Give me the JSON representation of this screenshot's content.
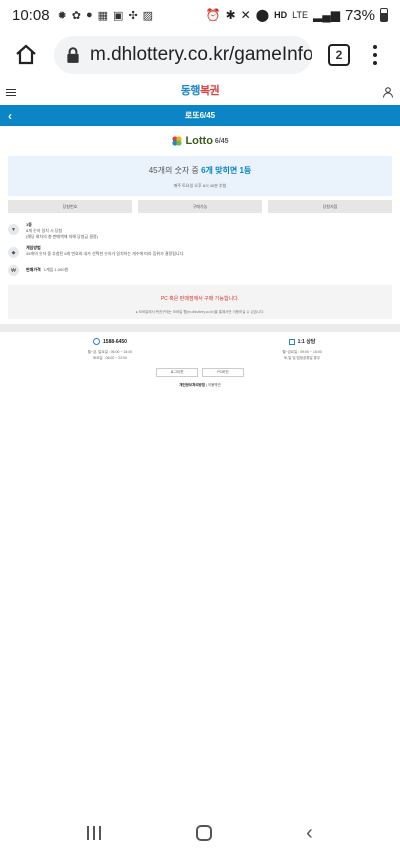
{
  "status_bar": {
    "time": "10:08",
    "battery": "73%",
    "network_hd": "HD",
    "network_lte": "LTE"
  },
  "chrome": {
    "url": "m.dhlottery.co.kr/gameInfo.",
    "tab_count": "2"
  },
  "site": {
    "logo_text_1": "동행",
    "logo_text_2": "복권",
    "page_title": "로또6/45"
  },
  "lotto": {
    "logo_text": "Lotto",
    "logo_sub": "6/45",
    "headline_prefix": "45개의 숫자 중 ",
    "headline_bold": "6개 맞히면 1등",
    "subline": "매주 토요일 오후 8시 45분 추첨"
  },
  "buttons": [
    "당첨번호",
    "구매가능",
    "당첨지점"
  ],
  "rules": [
    {
      "icon": "trophy-icon",
      "icon_glyph": "▼",
      "title": "1등",
      "lines": [
        "6개 숫자 일치 시 당첨",
        "(해당 회차의 총 판매액에 의해 당첨금 결정)"
      ]
    },
    {
      "icon": "game-icon",
      "icon_glyph": "◆",
      "title": "게임방법",
      "lines": [
        "45개의 숫자 중 추첨된 6개 번호와 내가 선택한 숫자가 일치하는 개수에 따라 등위가 결정됩니다."
      ]
    },
    {
      "icon": "price-icon",
      "icon_glyph": "₩",
      "title": "판매가격",
      "lines": [
        "1게임 1,000원"
      ]
    }
  ],
  "notice": {
    "red_text": "PC 혹은 판매점에서 구매 가능합니다.",
    "grey_text": "● 모바일에서 복권구매는 모바일 웹(m.dhlottery.co.kr)을 통해서만 이용하실 수 있습니다."
  },
  "footer": {
    "phone_title": "1588-6450",
    "phone_lines": [
      "월~금, 일요일 : 06:00 ~ 24:00",
      "토요일 : 06:00 ~ 22:00"
    ],
    "chat_title": "1:1 상담",
    "chat_lines": [
      "월~금요일 : 09:00 ~ 18:00",
      "토,일 및 법정공휴일 휴무"
    ],
    "btn_login": "로그아웃",
    "btn_pc": "PC버전",
    "link_privacy": "개인정보처리방침",
    "link_terms": "이용약관"
  }
}
